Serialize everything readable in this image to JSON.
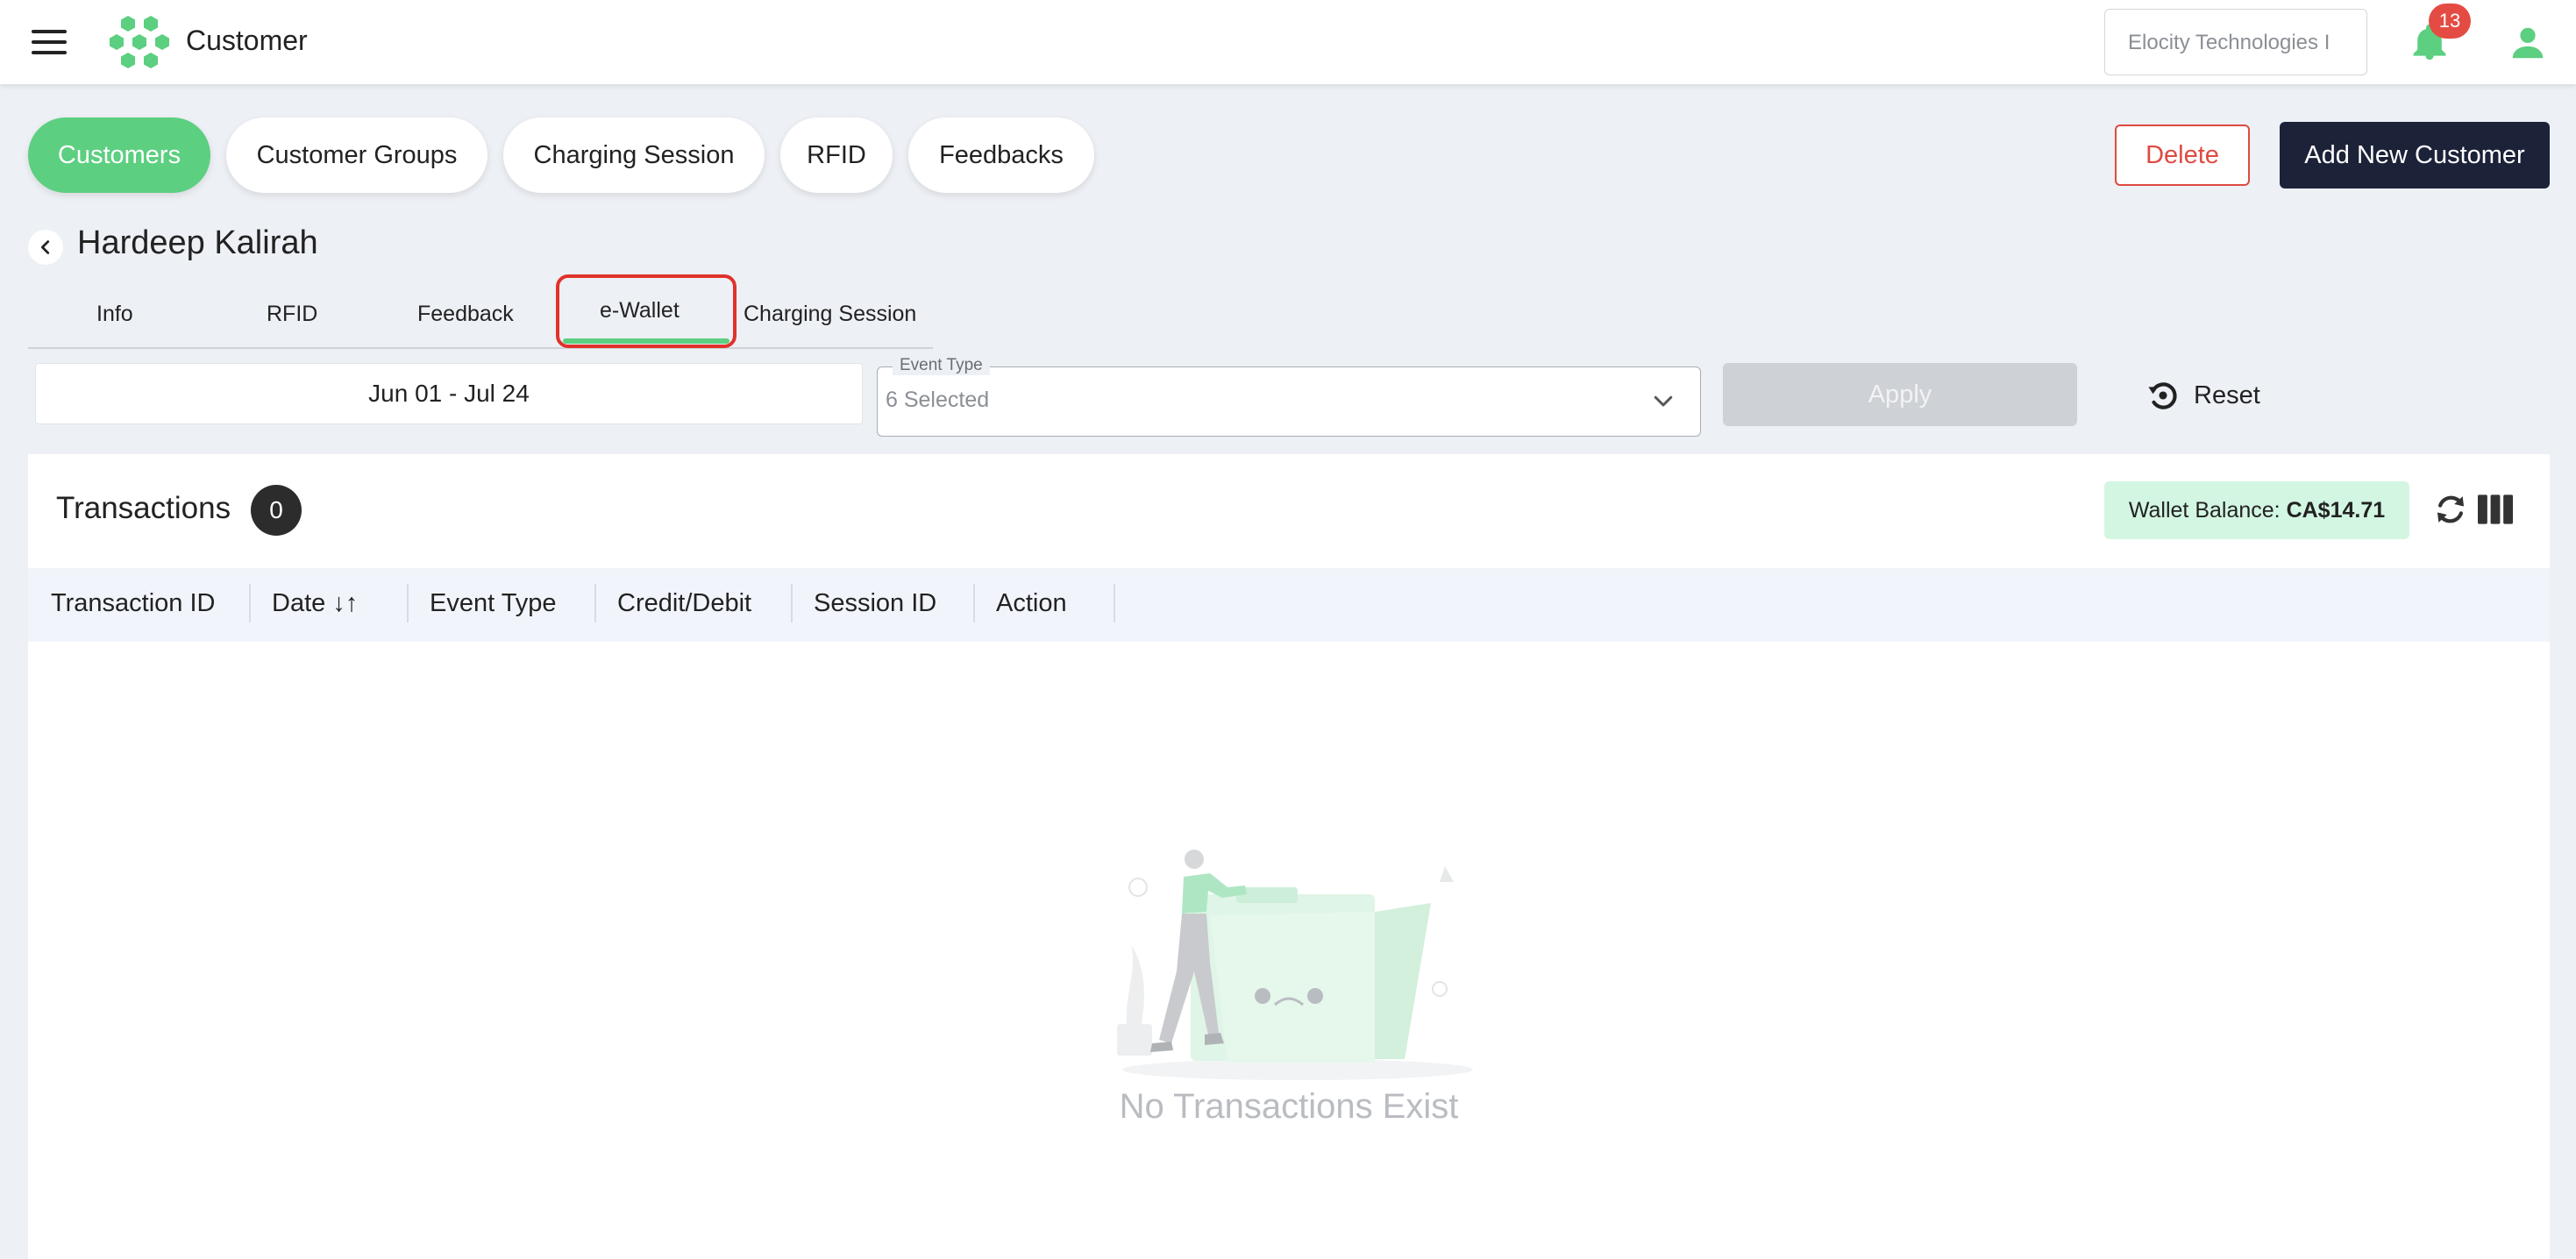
{
  "header": {
    "title": "Customer",
    "org_selector": "Elocity Technologies I",
    "notification_count": "13",
    "brand_color": "#5ccf80",
    "icons": [
      "menu-icon",
      "logo-icon",
      "bell-icon",
      "user-icon"
    ]
  },
  "main_tabs": [
    {
      "label": "Customers",
      "active": true
    },
    {
      "label": "Customer Groups",
      "active": false
    },
    {
      "label": "Charging Session",
      "active": false
    },
    {
      "label": "RFID",
      "active": false
    },
    {
      "label": "Feedbacks",
      "active": false
    }
  ],
  "actions": {
    "delete_label": "Delete",
    "add_label": "Add New Customer"
  },
  "customer": {
    "name": "Hardeep Kalirah"
  },
  "sub_tabs": [
    {
      "label": "Info",
      "active": false
    },
    {
      "label": "RFID",
      "active": false
    },
    {
      "label": "Feedback",
      "active": false
    },
    {
      "label": "e-Wallet",
      "active": true
    },
    {
      "label": "Charging Session",
      "active": false
    }
  ],
  "filters": {
    "date_range": "Jun 01 - Jul 24",
    "event_type_label": "Event Type",
    "event_type_value": "6 Selected",
    "apply_label": "Apply",
    "reset_label": "Reset"
  },
  "transactions": {
    "title": "Transactions",
    "count": "0",
    "wallet_label": "Wallet Balance:",
    "wallet_value": "CA$14.71",
    "columns": [
      "Transaction ID",
      "Date ↓↑",
      "Event Type",
      "Credit/Debit",
      "Session ID",
      "Action"
    ],
    "empty_message": "No Transactions Exist"
  }
}
